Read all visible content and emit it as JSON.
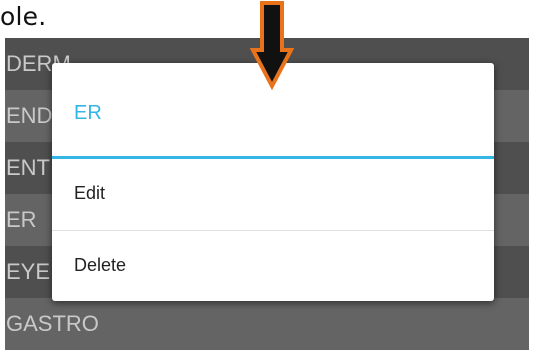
{
  "caption": {
    "text": "ole."
  },
  "list": {
    "items": [
      {
        "label": "DERM"
      },
      {
        "label": "END"
      },
      {
        "label": "ENT"
      },
      {
        "label": "ER"
      },
      {
        "label": "EYE"
      },
      {
        "label": "GASTRO"
      }
    ]
  },
  "dialog": {
    "title": "ER",
    "items": [
      {
        "label": "Edit"
      },
      {
        "label": "Delete"
      }
    ]
  },
  "annotation": {
    "icon": "down-arrow-icon",
    "fill_color": "#111111",
    "outline_color": "#e8731a"
  },
  "colors": {
    "accent": "#33b5e5"
  }
}
